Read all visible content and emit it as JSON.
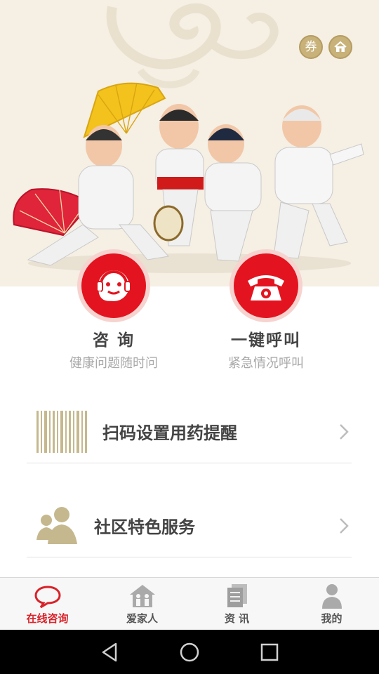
{
  "header": {
    "coupon_label": "券",
    "colors": {
      "gold": "#c8b27a",
      "red": "#e3141f",
      "cream": "#f5efe4"
    }
  },
  "hero": {
    "illustration": "elderly-people-dancing-with-fans",
    "icon_names": [
      "coupon-icon",
      "home-icon"
    ]
  },
  "actions": [
    {
      "title": "咨 询",
      "subtitle": "健康问题随时问",
      "icon": "headset-agent-icon"
    },
    {
      "title": "一键呼叫",
      "subtitle": "紧急情况呼叫",
      "icon": "telephone-icon"
    }
  ],
  "menu": [
    {
      "label": "扫码设置用药提醒",
      "icon": "barcode-icon"
    },
    {
      "label": "社区特色服务",
      "icon": "community-people-icon"
    }
  ],
  "tabs": [
    {
      "label": "在线咨询",
      "icon": "chat-bubble-icon",
      "active": true
    },
    {
      "label": "爱家人",
      "icon": "family-house-icon",
      "active": false
    },
    {
      "label": "资 讯",
      "icon": "news-document-icon",
      "active": false
    },
    {
      "label": "我的",
      "icon": "person-icon",
      "active": false
    }
  ],
  "system_nav": [
    "back-icon",
    "home-circle-icon",
    "recents-icon"
  ]
}
